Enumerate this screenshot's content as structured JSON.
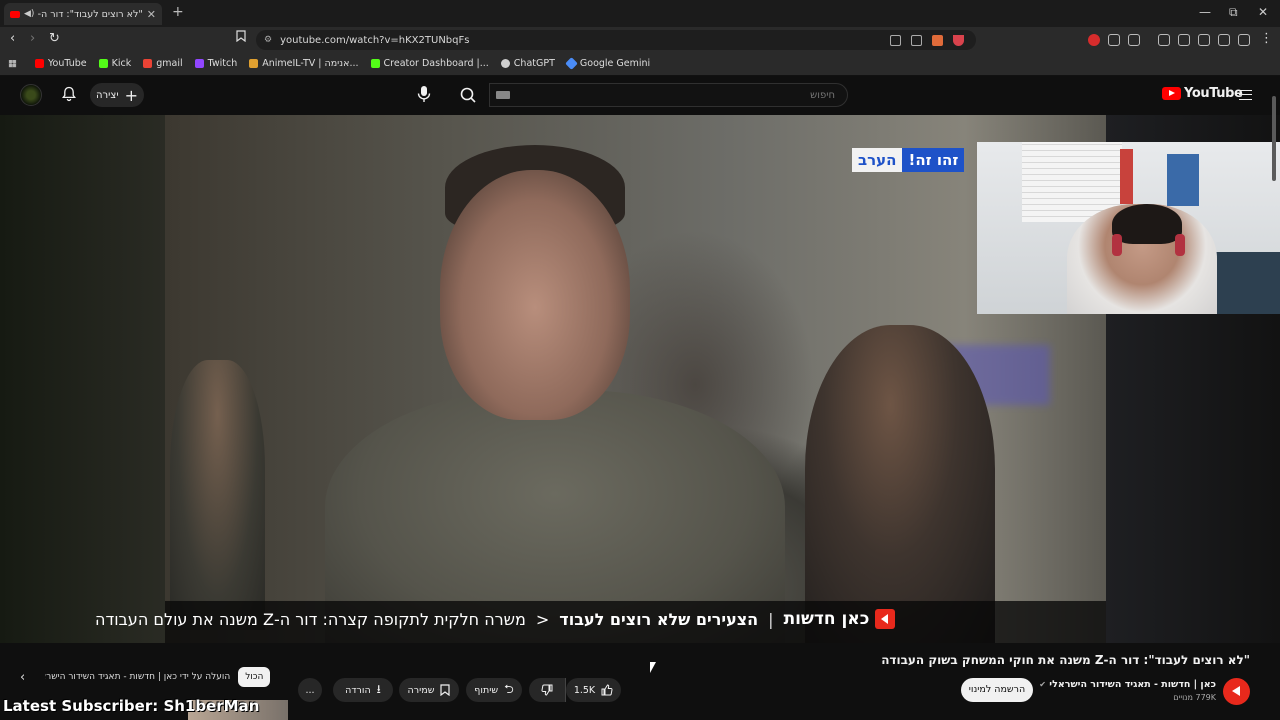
{
  "browser": {
    "tab_title": "\"לא רוצים לעבוד\": דור ה-Z מ...",
    "new_tab": "+",
    "url": "youtube.com/watch?v=hKX2TUNbqFs",
    "bookmarks": [
      {
        "label": "YouTube",
        "color": "#ff0000"
      },
      {
        "label": "Kick",
        "color": "#53fc18"
      },
      {
        "label": "gmail",
        "color": "#ea4335"
      },
      {
        "label": "Twitch",
        "color": "#9146ff"
      },
      {
        "label": "AnimeIL-TV | אנימה...",
        "color": "#e0a030"
      },
      {
        "label": "Creator Dashboard |...",
        "color": "#53fc18"
      },
      {
        "label": "ChatGPT",
        "color": "#cfcfcf"
      },
      {
        "label": "Google Gemini",
        "color": "#4a8cf7"
      }
    ]
  },
  "header": {
    "create_label": "יצירה",
    "search_placeholder": "חיפוש",
    "logo_text": "YouTube"
  },
  "video": {
    "badge_left": "הערב",
    "badge_right": "זהו זה!",
    "ticker_brand": "כאן חדשות",
    "ticker_separator": "|",
    "ticker_headline": "הצעירים שלא רוצים לעבוד",
    "ticker_chevron": "<",
    "ticker_sub": "משרה חלקית לתקופה קצרה: דור ה-Z משנה את עולם העבודה"
  },
  "below": {
    "title": "\"לא רוצים לעבוד\": דור ה-Z משנה את חוקי המשחק בשוק העבודה",
    "channel_name": "כאן | חדשות - תאגיד השידור הישראלי",
    "subscribers": "779K מנויים",
    "subscribe_label": "הרשמה למינוי",
    "likes": "1.5K",
    "share_label": "שיתוף",
    "save_label": "שמירה",
    "download_label": "הורדה",
    "more_label": "...",
    "chip_all": "הכול",
    "chip_uploaded": "הועלה על ידי כאן | חדשות - תאגיד השידור הישראלי"
  },
  "stream_overlay": {
    "latest_subscriber": "Latest Subscriber: Sh1berMan"
  }
}
